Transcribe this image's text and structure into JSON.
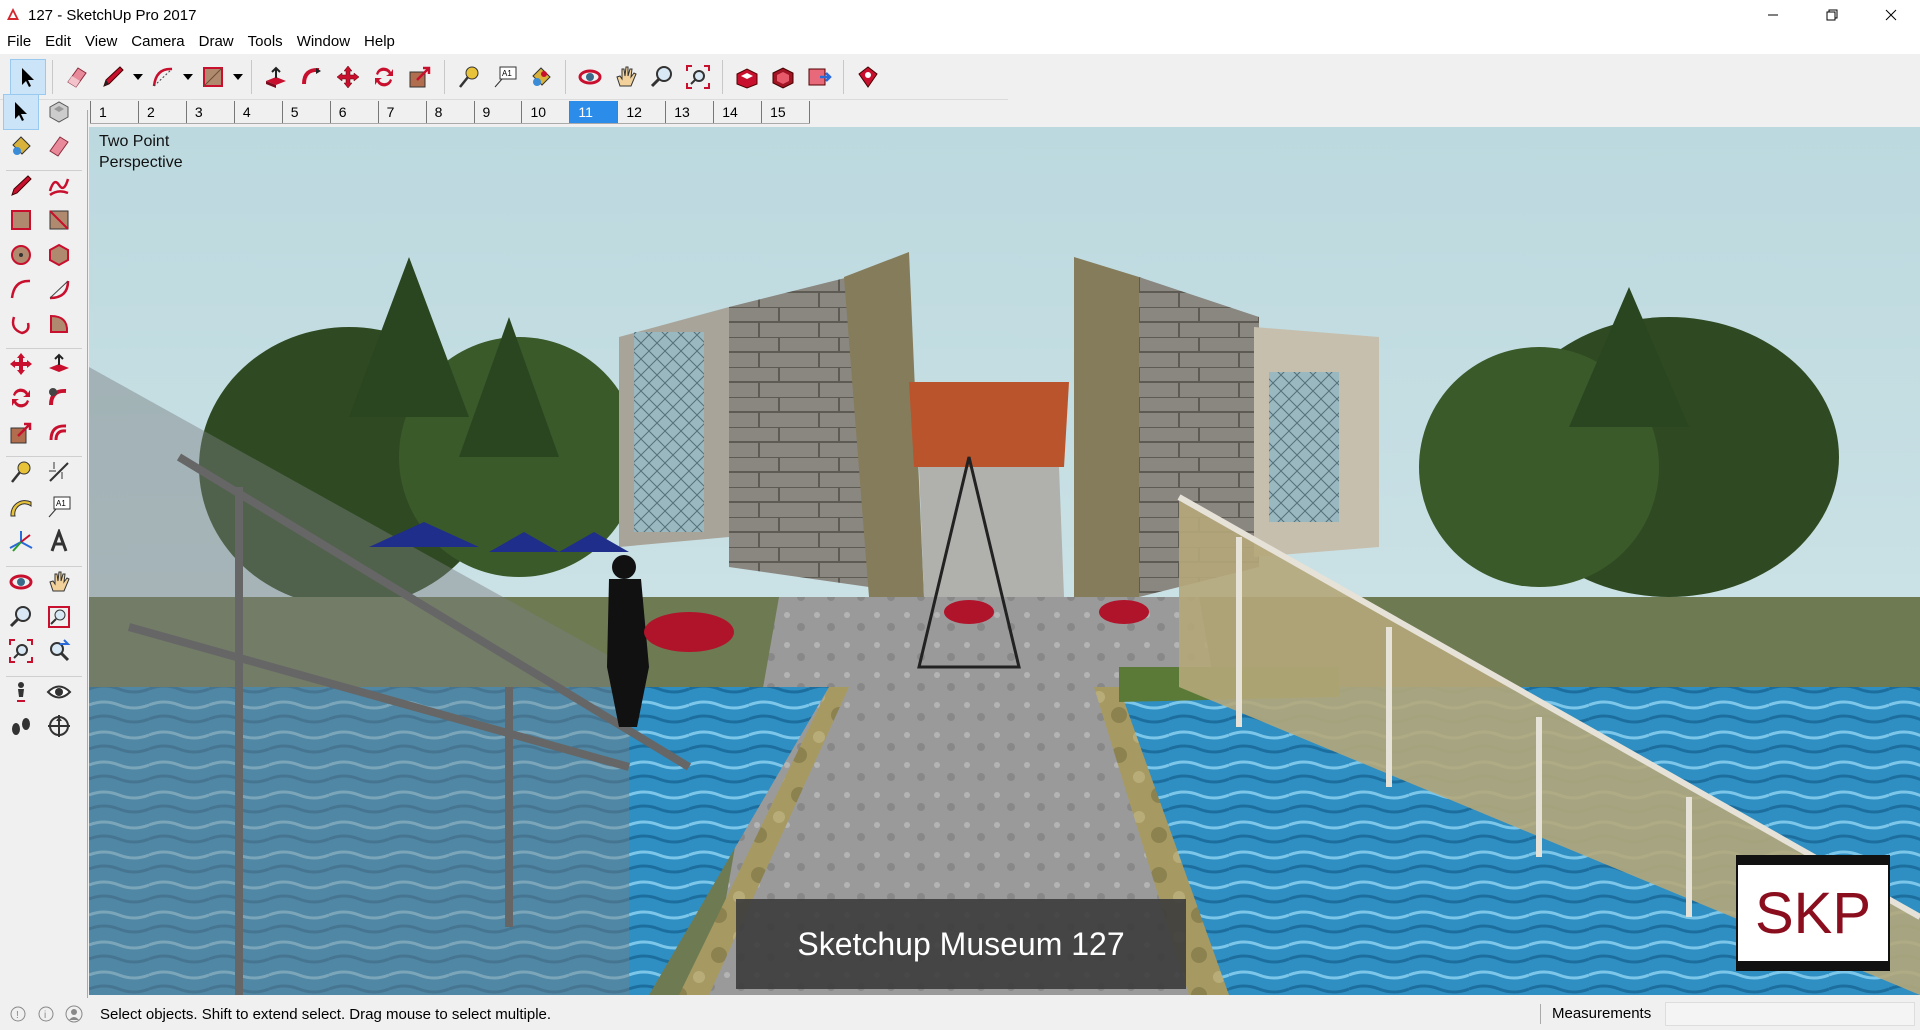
{
  "window": {
    "title": "127 - SketchUp Pro 2017",
    "controls": [
      "minimize-icon",
      "restore-icon",
      "close-icon"
    ]
  },
  "menu": [
    "File",
    "Edit",
    "View",
    "Camera",
    "Draw",
    "Tools",
    "Window",
    "Help"
  ],
  "toolbar": {
    "tools": [
      "select",
      "eraser",
      "line",
      "arc",
      "rectangle",
      "push-pull",
      "follow-me",
      "move",
      "rotate",
      "scale",
      "tape-measure",
      "text",
      "paint-bucket",
      "orbit",
      "pan",
      "zoom",
      "zoom-extents",
      "3d-warehouse",
      "extension-warehouse",
      "send-to-layout",
      "extension-manager"
    ]
  },
  "scenes": {
    "tabs": [
      "1",
      "2",
      "3",
      "4",
      "5",
      "6",
      "7",
      "8",
      "9",
      "10",
      "11",
      "12",
      "13",
      "14",
      "15"
    ],
    "active": "11"
  },
  "viewport": {
    "camera_label_line1": "Two Point",
    "camera_label_line2": "Perspective",
    "caption": "Sketchup Museum 127",
    "logo_text": "SKP"
  },
  "status": {
    "message": "Select objects. Shift to extend select. Drag mouse to select multiple.",
    "measurements_label": "Measurements",
    "measurements_value": ""
  }
}
